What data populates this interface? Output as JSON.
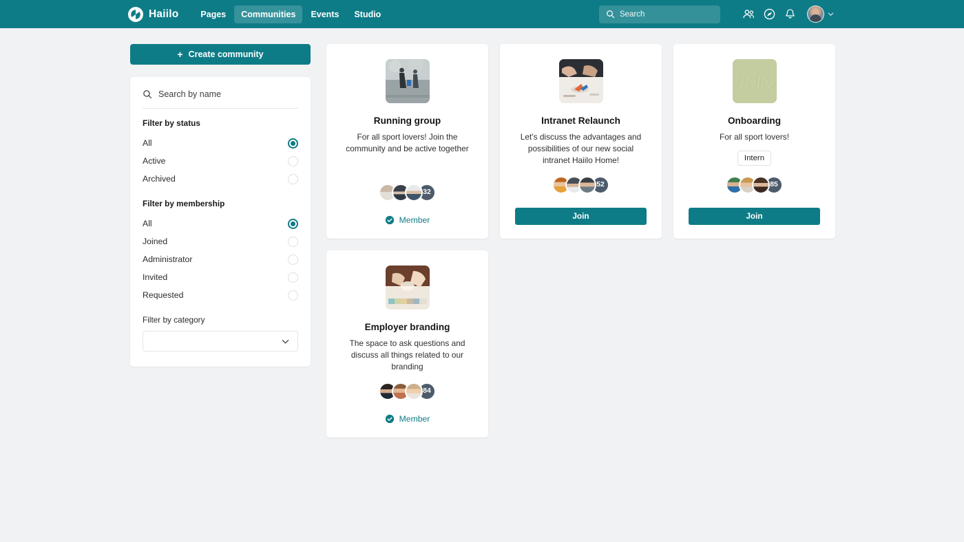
{
  "header": {
    "brand": "Haiilo",
    "nav": [
      {
        "label": "Pages",
        "active": false
      },
      {
        "label": "Communities",
        "active": true
      },
      {
        "label": "Events",
        "active": false
      },
      {
        "label": "Studio",
        "active": false
      }
    ],
    "search_placeholder": "Search",
    "icons": [
      "people-icon",
      "compass-icon",
      "bell-icon"
    ]
  },
  "sidebar": {
    "create_label": "Create community",
    "search_placeholder": "Search by name",
    "status": {
      "title": "Filter by status",
      "options": [
        {
          "label": "All",
          "selected": true
        },
        {
          "label": "Active",
          "selected": false
        },
        {
          "label": "Archived",
          "selected": false
        }
      ]
    },
    "membership": {
      "title": "Filter by membership",
      "options": [
        {
          "label": "All",
          "selected": true
        },
        {
          "label": "Joined",
          "selected": false
        },
        {
          "label": "Administrator",
          "selected": false
        },
        {
          "label": "Invited",
          "selected": false
        },
        {
          "label": "Requested",
          "selected": false
        }
      ]
    },
    "category": {
      "title": "Filter by category",
      "value": ""
    }
  },
  "cards": [
    {
      "title": "Running group",
      "description": "For all sport lovers! Join the community and be active together",
      "tag": null,
      "member_count": "32",
      "action": "member",
      "action_label": "Member",
      "thumb": "runners-photo"
    },
    {
      "title": "Intranet Relaunch",
      "description": "Let's discuss the advantages and possibilities of our new social intranet Haiilo Home!",
      "tag": null,
      "member_count": "52",
      "action": "join",
      "action_label": "Join",
      "thumb": "desk-workshop-photo"
    },
    {
      "title": "Onboarding",
      "description": "For all sport lovers!",
      "tag": "Intern",
      "member_count": "85",
      "action": "join",
      "action_label": "Join",
      "thumb": "hello-sign-photo"
    },
    {
      "title": "Employer branding",
      "description": "The space to ask questions and discuss all things related to our branding",
      "tag": null,
      "member_count": "84",
      "action": "member",
      "action_label": "Member",
      "thumb": "handshake-photo"
    }
  ],
  "colors": {
    "brand_teal": "#0e7c87",
    "page_bg": "#f1f2f4",
    "count_badge": "#4d5b6b"
  }
}
